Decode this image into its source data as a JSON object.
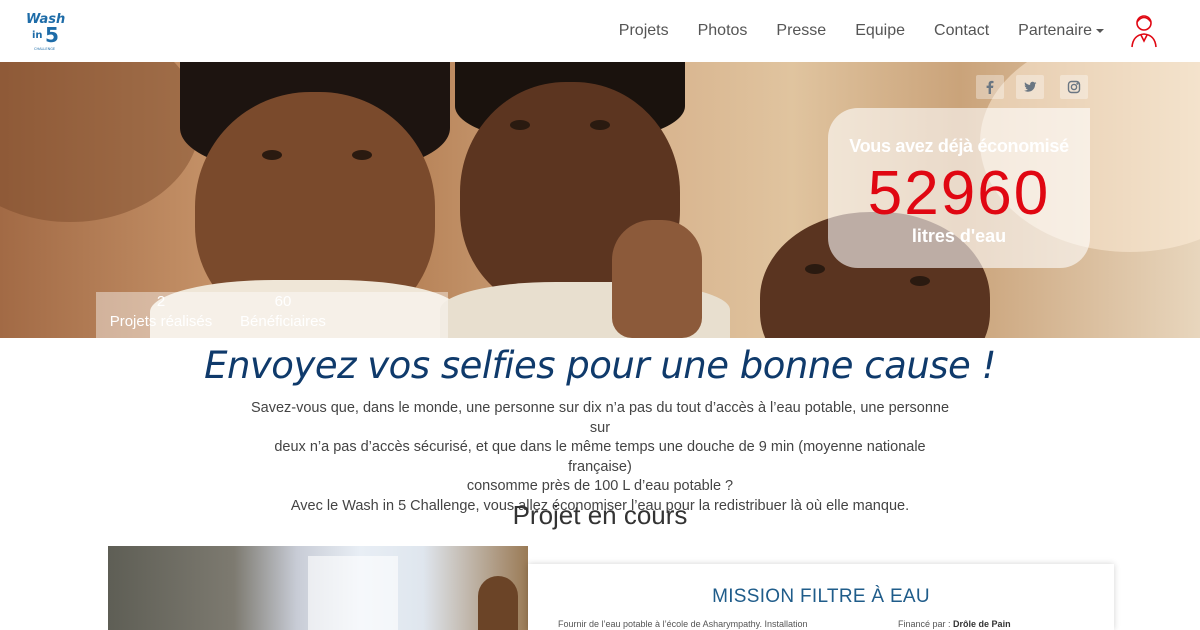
{
  "brand": {
    "logo_text_top": "Wash",
    "logo_text_mid": "in",
    "logo_text_num": "5",
    "logo_text_bottom": "CHALLENGE"
  },
  "nav": {
    "items": [
      "Projets",
      "Photos",
      "Presse",
      "Equipe",
      "Contact"
    ],
    "dropdown_label": "Partenaire"
  },
  "hero": {
    "counter_pre": "Vous avez déjà économisé",
    "counter_value": "52960",
    "counter_unit": "litres d'eau",
    "stats": [
      {
        "value": "2",
        "label": "Projets réalisés"
      },
      {
        "value": "60",
        "label": "Bénéficiaires"
      }
    ],
    "social_icons": [
      "facebook-icon",
      "twitter-icon",
      "instagram-icon"
    ]
  },
  "main": {
    "headline": "Envoyez vos selfies pour une bonne cause !",
    "intro_lines": [
      "Savez-vous que, dans le monde, une personne sur dix n’a pas du tout d’accès à l’eau potable, une personne sur",
      "deux n’a pas d’accès sécurisé, et que dans le même temps une douche de 9 min (moyenne nationale française)",
      "consomme près de 100 L d’eau potable ?",
      "Avec le Wash in 5 Challenge, vous allez économiser l’eau pour la redistribuer là où elle manque."
    ],
    "section_title": "Projet en cours"
  },
  "project": {
    "title": "MISSION FILTRE À EAU",
    "description": "Fournir de l’eau potable à l’école de Asharympathy. Installation",
    "funded_label": "Financé par :",
    "funded_by": "Drôle de Pain"
  },
  "colors": {
    "accent_red": "#e00712",
    "headline_blue": "#0f3a6b",
    "card_title_blue": "#1f5c8a"
  }
}
